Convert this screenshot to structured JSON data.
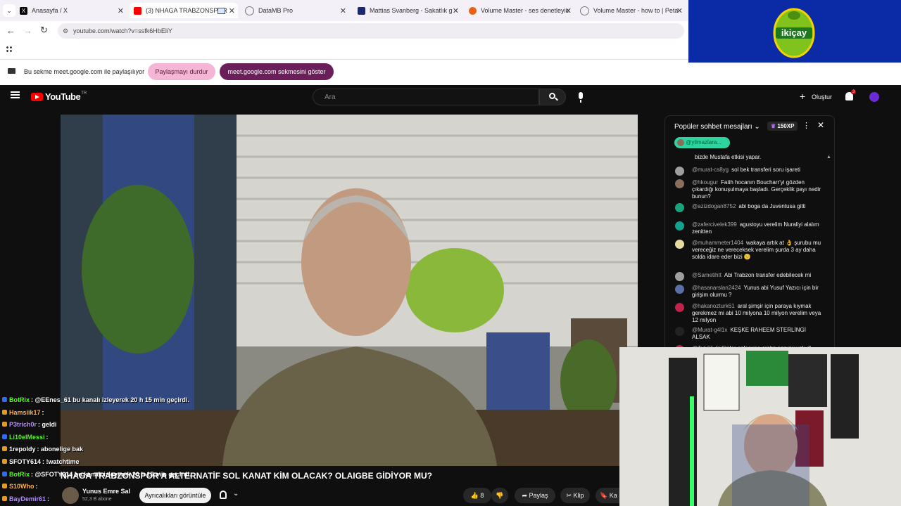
{
  "browser": {
    "tabs": [
      {
        "label": "Anasayfa / X",
        "favicon": "x-logo-icon",
        "active": false
      },
      {
        "label": "(3) NHAGA TRABZONSPOR",
        "favicon": "youtube-icon",
        "active": true
      },
      {
        "label": "DataMB Pro",
        "favicon": "datamb-icon",
        "active": false
      },
      {
        "label": "Mattias Svanberg - Sakatlık geç",
        "favicon": "fm-icon",
        "active": false
      },
      {
        "label": "Volume Master - ses denetleyic",
        "favicon": "volume-master-icon",
        "active": false
      },
      {
        "label": "Volume Master - how to | Peta",
        "favicon": "globe-icon",
        "active": false
      }
    ],
    "url": "youtube.com/watch?v=ssfk6HbEliY"
  },
  "sharebar": {
    "message": "Bu sekme meet.google.com ile paylaşılıyor",
    "stop_label": "Paylaşmayı durdur",
    "show_label": "meet.google.com sekmesini göster"
  },
  "overlay_logo": {
    "text": "ikiçay"
  },
  "youtube": {
    "logo_text": "YouTube",
    "region": "TR",
    "search_placeholder": "Ara",
    "create_label": "Oluştur",
    "notif_count": "3"
  },
  "chat": {
    "header": "Popüler sohbet mesajları",
    "xp": "150XP",
    "pinned": "@yilmazlara...",
    "messages": [
      {
        "author": "",
        "text": "bizde Mustafa etkisi yapar.",
        "color": "#888888"
      },
      {
        "author": "@murat-cs8yg",
        "text": "sol bek transferi soru işareti",
        "color": "#9e9e9e"
      },
      {
        "author": "@hkougur",
        "text": "Fatih hocanın Boucharr'yi gözden çıkardığı konuşulmaya başladı. Gerçeklik payı nedir bunun?",
        "color": "#8a6d5a"
      },
      {
        "author": "@azizdogan8752",
        "text": "abi boga da Juventusa gitti",
        "color": "#1aa37a"
      },
      {
        "author": "@zafercivelek399",
        "text": "agustoyu verelim Nuraliyi alalım zenitten",
        "color": "#12a38f"
      },
      {
        "author": "@muhammeter1404",
        "text": "wakaya artık at 👌 şurubu mu vereceğiz ne vereceksek verelim şurda 3 ay daha solda idare eder bizi 🙂",
        "color": "#e8d9a0"
      },
      {
        "author": "@Sametihtt",
        "text": "Abi Trabzon transfer edebilecek mi",
        "color": "#9e9e9e"
      },
      {
        "author": "@hasanarslan2424",
        "text": "Yunus abi Yusuf Yazıcı için bir girişim olurmu ?",
        "color": "#5a6ea8"
      },
      {
        "author": "@hakanozturk61",
        "text": "aral şimşir için paraya kıymak gerekmez mi abi 10 milyona 10 milyon verelim veya 12 milyon",
        "color": "#c0224a"
      },
      {
        "author": "@Murat-g4l1x",
        "text": "KEŞKE RAHEEM STERLİNGİ ALSAK",
        "color": "#222222"
      },
      {
        "author": "@Tut 61",
        "text": "kulüpler anlaşırsa aralın sorunu yok di",
        "color": "#c0224a"
      }
    ]
  },
  "stream_chat": [
    {
      "user": "BotRix",
      "text": ": @EEnes_61 bu kanalı izleyerek 20 h 15 min geçirdi.",
      "color": "#53fc18"
    },
    {
      "user": "Hamsiik17",
      "text": ":",
      "color": "#ffb64d"
    },
    {
      "user": "P3trich0r",
      "text": ": geldi",
      "color": "#b794f6"
    },
    {
      "user": "Li10elMessi",
      "text": ":",
      "color": "#53fc18"
    },
    {
      "user": "1repoldy",
      "text": ": abonelige bak",
      "color": "#ffffff"
    },
    {
      "user": "SFOTY614",
      "text": ": !watchtime",
      "color": "#ffffff"
    },
    {
      "user": "BotRix",
      "text": ": @SFOTY614 bu kanalı izleyerek 20 h 15 min geçirdi.",
      "color": "#53fc18"
    },
    {
      "user": "S10Who",
      "text": ":",
      "color": "#ffb64d"
    },
    {
      "user": "BayDemir61",
      "text": ":",
      "color": "#b794f6"
    }
  ],
  "video": {
    "title": "NHAGA TRABZONSPOR'A ALTERNATİF SOL KANAT KİM OLACAK? OLAIGBE GİDİYOR MU?",
    "channel": "Yunus Emre Sal",
    "subscribers": "52,3 B abone",
    "join_label": "Ayrıcalıkları görüntüle",
    "likes": "8",
    "share_label": "Paylaş",
    "clip_label": "Klip",
    "save_label": "Ka"
  },
  "colors": {
    "accent_pink": "#f5b6d6",
    "accent_purple": "#6b1f5a",
    "yt_red": "#ff0000"
  }
}
